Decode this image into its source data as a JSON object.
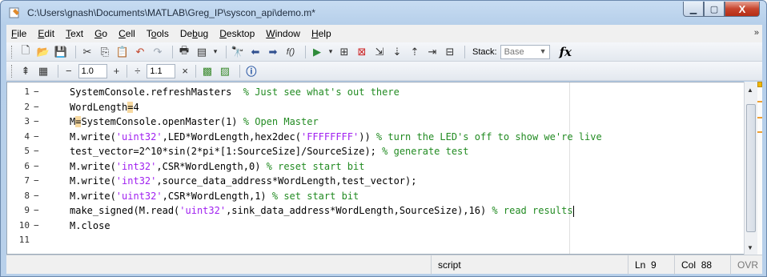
{
  "window": {
    "title": "C:\\Users\\gnash\\Documents\\MATLAB\\Greg_IP\\syscon_api\\demo.m*",
    "minimize_icon": "minimize-icon",
    "maximize_icon": "maximize-icon",
    "close_glyph": "X"
  },
  "menu": {
    "items": [
      {
        "label": "File",
        "accel_index": 0
      },
      {
        "label": "Edit",
        "accel_index": 0
      },
      {
        "label": "Text",
        "accel_index": 0
      },
      {
        "label": "Go",
        "accel_index": 0
      },
      {
        "label": "Cell",
        "accel_index": 0
      },
      {
        "label": "Tools",
        "accel_index": 1
      },
      {
        "label": "Debug",
        "accel_index": 2
      },
      {
        "label": "Desktop",
        "accel_index": 0
      },
      {
        "label": "Window",
        "accel_index": 0
      },
      {
        "label": "Help",
        "accel_index": 0
      }
    ]
  },
  "toolbar": {
    "stack_label": "Stack:",
    "stack_value": "Base",
    "fx_label": "fx",
    "cell_decrement": "−",
    "cell_increment_value": "1.0",
    "plus": "+",
    "divide": "÷",
    "divide_value": "1.1",
    "times": "×"
  },
  "editor": {
    "lines": [
      {
        "n": "1",
        "segs": [
          [
            "code",
            "SystemConsole.refreshMasters  "
          ],
          [
            "cmt",
            "% Just see what's out there"
          ]
        ]
      },
      {
        "n": "2",
        "segs": [
          [
            "code",
            "WordLength"
          ],
          [
            "hl",
            "="
          ],
          [
            "code",
            "4"
          ]
        ]
      },
      {
        "n": "3",
        "segs": [
          [
            "code",
            "M"
          ],
          [
            "hl",
            "="
          ],
          [
            "code",
            "SystemConsole.openMaster(1) "
          ],
          [
            "cmt",
            "% Open Master"
          ]
        ]
      },
      {
        "n": "4",
        "segs": [
          [
            "code",
            "M.write("
          ],
          [
            "str",
            "'uint32'"
          ],
          [
            "code",
            ",LED*WordLength,hex2dec("
          ],
          [
            "str",
            "'FFFFFFFF'"
          ],
          [
            "code",
            ")) "
          ],
          [
            "cmt",
            "% turn the LED's off to show we're live"
          ]
        ]
      },
      {
        "n": "5",
        "segs": [
          [
            "code",
            "test_vector=2^10*sin(2*pi*[1:SourceSize]/SourceSize); "
          ],
          [
            "cmt",
            "% generate test"
          ]
        ]
      },
      {
        "n": "6",
        "segs": [
          [
            "code",
            "M.write("
          ],
          [
            "str",
            "'int32'"
          ],
          [
            "code",
            ",CSR*WordLength,0) "
          ],
          [
            "cmt",
            "% reset start bit"
          ]
        ]
      },
      {
        "n": "7",
        "segs": [
          [
            "code",
            "M.write("
          ],
          [
            "str",
            "'int32'"
          ],
          [
            "code",
            ",source_data_address*WordLength,test_vector);"
          ]
        ]
      },
      {
        "n": "8",
        "segs": [
          [
            "code",
            "M.write("
          ],
          [
            "str",
            "'uint32'"
          ],
          [
            "code",
            ",CSR*WordLength,1) "
          ],
          [
            "cmt",
            "% set start bit"
          ]
        ]
      },
      {
        "n": "9",
        "segs": [
          [
            "code",
            "make_signed(M.read("
          ],
          [
            "str",
            "'uint32'"
          ],
          [
            "code",
            ",sink_data_address*WordLength,SourceSize),16) "
          ],
          [
            "cmt",
            "% read results"
          ]
        ]
      },
      {
        "n": "10",
        "segs": [
          [
            "code",
            "M.close"
          ]
        ]
      },
      {
        "n": "11",
        "segs": []
      }
    ]
  },
  "status": {
    "mode": "script",
    "ln_label": "Ln",
    "ln_value": "9",
    "col_label": "Col",
    "col_value": "88",
    "ovr": "OVR"
  },
  "colors": {
    "string": "#a020f0",
    "comment": "#228b22",
    "highlight": "#f7d9a0"
  }
}
